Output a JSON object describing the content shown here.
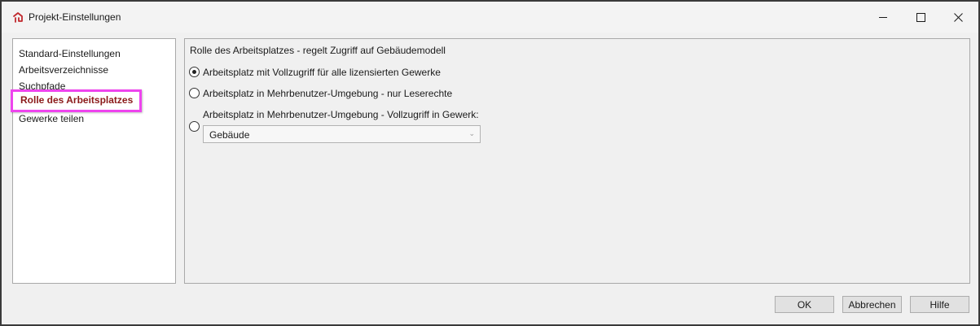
{
  "window": {
    "title": "Projekt-Einstellungen",
    "icon": "app-logo-icon",
    "accent_color": "#c0282d"
  },
  "sidebar": {
    "items": [
      {
        "label": "Standard-Einstellungen"
      },
      {
        "label": "Arbeitsverzeichnisse"
      },
      {
        "label": "Suchpfade"
      },
      {
        "label": "Rolle des Arbeitsplatzes",
        "selected": true
      },
      {
        "label": "Gewerke teilen"
      }
    ],
    "highlight_color": "#ee44ee"
  },
  "main": {
    "section_title": "Rolle des Arbeitsplatzes - regelt Zugriff auf Gebäudemodell",
    "options": [
      {
        "label": "Arbeitsplatz mit Vollzugriff für alle lizensierten Gewerke",
        "checked": true
      },
      {
        "label": "Arbeitsplatz in Mehrbenutzer-Umgebung - nur Leserechte",
        "checked": false
      },
      {
        "label": "Arbeitsplatz in Mehrbenutzer-Umgebung - Vollzugriff in Gewerk:",
        "checked": false
      }
    ],
    "trade_select": {
      "value": "Gebäude",
      "enabled": false
    }
  },
  "footer": {
    "ok_label": "OK",
    "cancel_label": "Abbrechen",
    "help_label": "Hilfe"
  }
}
